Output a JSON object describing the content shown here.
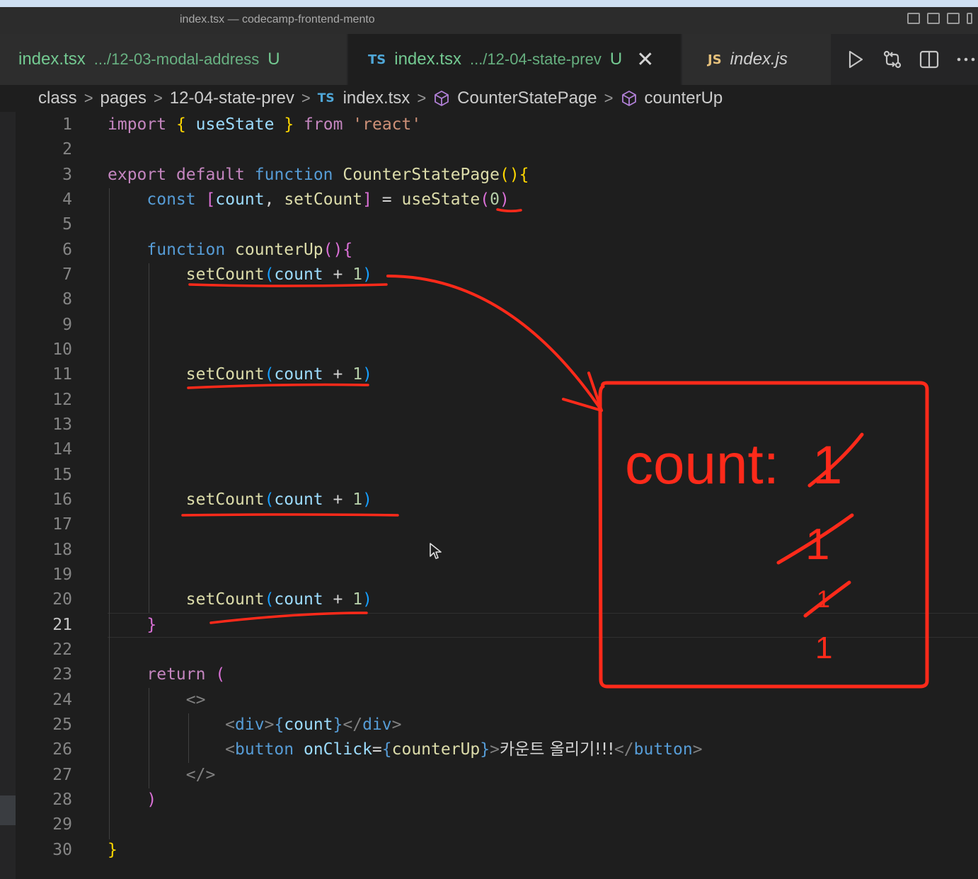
{
  "window": {
    "title": "index.tsx — codecamp-frontend-mento"
  },
  "tabs": [
    {
      "badge": "",
      "name": "index.tsx",
      "path": ".../12-03-modal-address",
      "status": "U",
      "active": false
    },
    {
      "badge": "TS",
      "name": "index.tsx",
      "path": ".../12-04-state-prev",
      "status": "U",
      "active": true,
      "close": "✕"
    },
    {
      "badge": "JS",
      "name": "index.js",
      "path": "",
      "status": "",
      "active": false
    }
  ],
  "editor_actions": [
    "run-icon",
    "compare-changes-icon",
    "split-editor-icon",
    "more-actions-icon"
  ],
  "breadcrumb": {
    "items": [
      "class",
      "pages",
      "12-04-state-prev",
      "index.tsx",
      "CounterStatePage",
      "counterUp"
    ],
    "file_badge": "TS"
  },
  "code": {
    "current_line": 21,
    "lines": [
      {
        "n": "1"
      },
      {
        "n": "2"
      },
      {
        "n": "3"
      },
      {
        "n": "4"
      },
      {
        "n": "5"
      },
      {
        "n": "6"
      },
      {
        "n": "7"
      },
      {
        "n": "8"
      },
      {
        "n": "9"
      },
      {
        "n": "10"
      },
      {
        "n": "11"
      },
      {
        "n": "12"
      },
      {
        "n": "13"
      },
      {
        "n": "14"
      },
      {
        "n": "15"
      },
      {
        "n": "16"
      },
      {
        "n": "17"
      },
      {
        "n": "18"
      },
      {
        "n": "19"
      },
      {
        "n": "20"
      },
      {
        "n": "21"
      },
      {
        "n": "22"
      },
      {
        "n": "23"
      },
      {
        "n": "24"
      },
      {
        "n": "25"
      },
      {
        "n": "26"
      },
      {
        "n": "27"
      },
      {
        "n": "28"
      },
      {
        "n": "29"
      },
      {
        "n": "30"
      }
    ],
    "tokens": {
      "l1": [
        "import",
        " ",
        "{",
        " ",
        "useState",
        " ",
        "}",
        " ",
        "from",
        " ",
        "'react'"
      ],
      "l3": [
        "export",
        " ",
        "default",
        " ",
        "function",
        " ",
        "CounterStatePage",
        "(",
        ")",
        "{"
      ],
      "l4": [
        "const",
        " ",
        "[",
        "count",
        ", ",
        "setCount",
        "]",
        " = ",
        "useState",
        "(",
        "0",
        ")"
      ],
      "l6": [
        "function",
        " ",
        "counterUp",
        "(",
        ")",
        "{"
      ],
      "set": [
        "setCount",
        "(",
        "count",
        " + ",
        "1",
        ")"
      ],
      "l21": [
        "}"
      ],
      "l23": [
        "return",
        " ",
        "("
      ],
      "l24": [
        "<>"
      ],
      "l25": [
        "<",
        "div",
        ">",
        "{",
        "count",
        "}",
        "</",
        "div",
        ">"
      ],
      "l26": [
        "<",
        "button",
        " ",
        "onClick",
        "=",
        "{",
        "counterUp",
        "}",
        ">",
        "카운트 올리기!!!",
        "</",
        "button",
        ">"
      ],
      "l27": [
        "</>"
      ],
      "l28": [
        ")"
      ],
      "l30": [
        "}"
      ]
    }
  },
  "annotation": {
    "color": "#ff2a1a",
    "label": "count:",
    "values": [
      "1",
      "1",
      "1",
      "1"
    ],
    "struck": [
      true,
      true,
      true,
      false
    ]
  }
}
